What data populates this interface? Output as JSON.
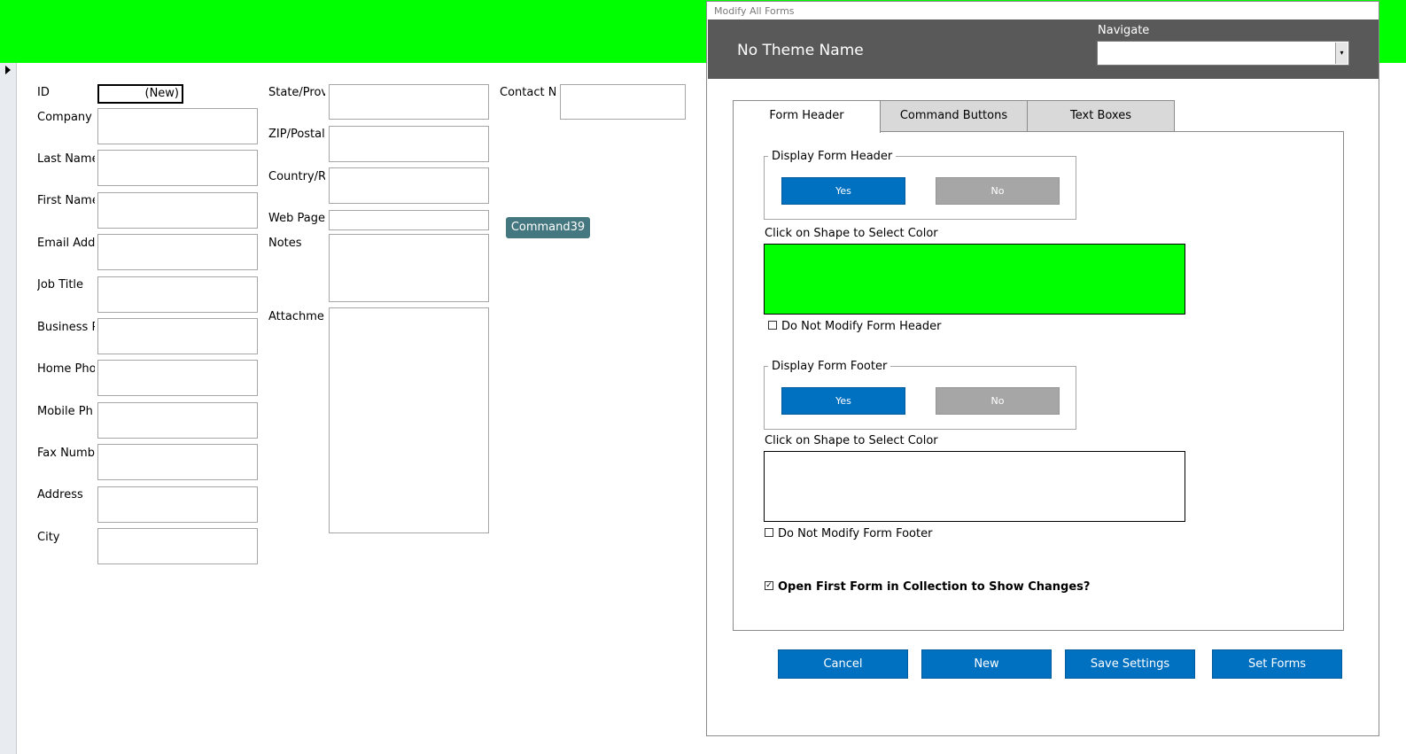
{
  "form": {
    "fields_col1": [
      {
        "label": "ID",
        "value": "(New)"
      },
      {
        "label": "Company"
      },
      {
        "label": "Last Name"
      },
      {
        "label": "First Name"
      },
      {
        "label": "Email Add"
      },
      {
        "label": "Job Title"
      },
      {
        "label": "Business P"
      },
      {
        "label": "Home Pho"
      },
      {
        "label": "Mobile Ph"
      },
      {
        "label": "Fax Numb"
      },
      {
        "label": "Address"
      },
      {
        "label": "City"
      }
    ],
    "fields_col2": [
      {
        "label": "State/Prov"
      },
      {
        "label": "ZIP/Postal"
      },
      {
        "label": "Country/R"
      },
      {
        "label": "Web Page"
      },
      {
        "label": "Notes"
      },
      {
        "label": "Attachmer"
      }
    ],
    "contact_label": "Contact Na",
    "command_button": "Command39",
    "header_color": "#00ff00"
  },
  "dialog": {
    "title": "Modify All Forms",
    "theme_name": "No Theme Name",
    "navigate_label": "Navigate",
    "navigate_value": "",
    "tabs": [
      {
        "label": "Form Header",
        "active": true
      },
      {
        "label": "Command Buttons",
        "active": false
      },
      {
        "label": "Text Boxes",
        "active": false
      }
    ],
    "header_section": {
      "group_label": "Display Form Header",
      "yes_label": "Yes",
      "no_label": "No",
      "selected": "Yes",
      "color_prompt": "Click on Shape to Select Color",
      "color": "#00ff00",
      "checkbox_label": "Do Not Modify Form Header",
      "checked": false
    },
    "footer_section": {
      "group_label": "Display Form Footer",
      "yes_label": "Yes",
      "no_label": "No",
      "selected": "Yes",
      "color_prompt": "Click on Shape to Select Color",
      "color": "#ffffff",
      "checkbox_label": "Do Not Modify Form Footer",
      "checked": false
    },
    "open_first_form": {
      "label": "Open First Form in Collection to Show Changes?",
      "checked": true
    },
    "buttons": {
      "cancel": "Cancel",
      "new": "New",
      "save": "Save Settings",
      "set_forms": "Set Forms"
    }
  }
}
